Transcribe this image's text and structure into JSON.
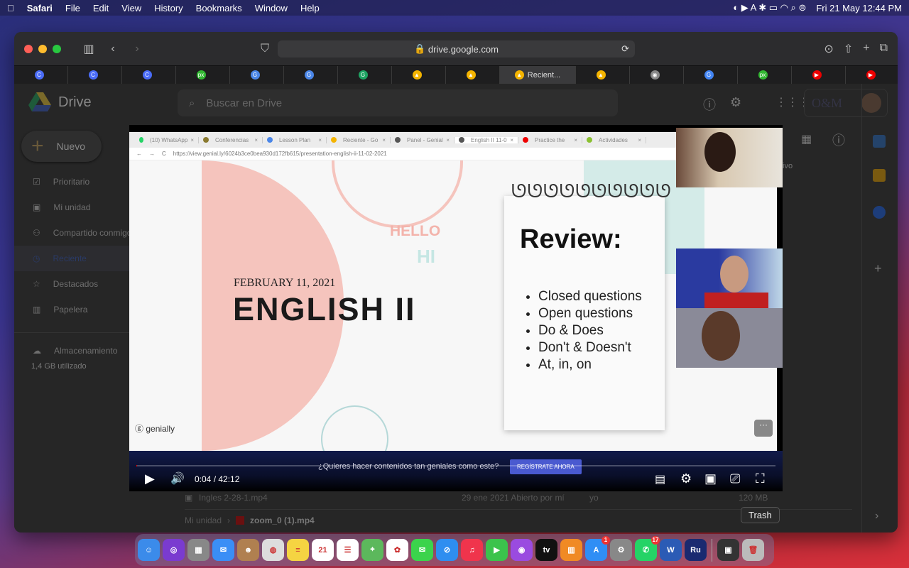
{
  "menubar": {
    "app": "Safari",
    "items": [
      "File",
      "Edit",
      "View",
      "History",
      "Bookmarks",
      "Window",
      "Help"
    ],
    "clock": "Fri 21 May  12:44 PM"
  },
  "safari": {
    "url": "drive.google.com",
    "active_tab": "Recient...",
    "tab_favicons": [
      {
        "c": "#4a6cf7",
        "t": "C"
      },
      {
        "c": "#4a6cf7",
        "t": "C"
      },
      {
        "c": "#4a6cf7",
        "t": "C"
      },
      {
        "c": "#33b833",
        "t": "px"
      },
      {
        "c": "#4a86e8",
        "t": "G"
      },
      {
        "c": "#4a86e8",
        "t": "G"
      },
      {
        "c": "#1ea362",
        "t": "G"
      },
      {
        "c": "#f4b400",
        "t": "▲"
      },
      {
        "c": "#f4b400",
        "t": "▲"
      },
      {
        "c": "#f4b400",
        "t": "▲"
      },
      {
        "c": "#888",
        "t": "◉"
      },
      {
        "c": "#4285f4",
        "t": "G"
      },
      {
        "c": "#33b833",
        "t": "px"
      },
      {
        "c": "#e00",
        "t": "▶"
      },
      {
        "c": "#e00",
        "t": "▶"
      },
      {
        "c": "#4a86e8",
        "t": "↓"
      }
    ]
  },
  "drive": {
    "logo": "Drive",
    "search_placeholder": "Buscar en Drive",
    "new_button": "Nuevo",
    "nav": [
      "Prioritario",
      "Mi unidad",
      "Compartido conmigo",
      "Reciente",
      "Destacados",
      "Papelera"
    ],
    "storage_label": "Almacenamiento",
    "storage_used": "1,4 GB utilizado",
    "header_partial": "ivo",
    "row": {
      "name": "Ingles 2-28-1.mp4",
      "date": "29 ene 2021  Abierto por mí",
      "owner": "yo",
      "size": "120 MB"
    },
    "breadcrumb": {
      "root": "Mi unidad",
      "file": "zoom_0 (1).mp4"
    },
    "org": "O&M"
  },
  "video": {
    "chrome_tabs": [
      "(10) WhatsApp",
      "Conferencias",
      "Lesson Plan",
      "Reciente - Go",
      "Panel - Genial",
      "English II 11-0",
      "Practice the",
      "Actividades"
    ],
    "chrome_url": "https://view.genial.ly/6024b3ce0bea930d172fb615/presentation-english-ii-11-02-2021",
    "slide": {
      "hello": "HELLO",
      "hi": "HI",
      "date": "FEBRUARY 11, 2021",
      "title": "ENGLISH II",
      "review": "Review:",
      "bullets": [
        "Closed questions",
        "Open questions",
        "Do & Does",
        "Don't & Doesn't",
        "At, in, on"
      ],
      "brand": "genially"
    },
    "banner_text": "¿Quieres hacer contenidos tan geniales como este?",
    "banner_button": "REGÍSTRATE AHORA",
    "time": "0:04 / 42:12",
    "progress": 0.0016
  },
  "dock": {
    "tooltip": "Trash",
    "apps": [
      {
        "n": "finder",
        "c": "#3b8bea",
        "t": "☺"
      },
      {
        "n": "siri",
        "c": "#7a3bd0",
        "t": "◎"
      },
      {
        "n": "launchpad",
        "c": "#888",
        "t": "▦"
      },
      {
        "n": "mail",
        "c": "#3a8ef6",
        "t": "✉"
      },
      {
        "n": "contacts",
        "c": "#b08050",
        "t": "☻"
      },
      {
        "n": "chrome",
        "c": "#ddd",
        "t": "◍"
      },
      {
        "n": "notes",
        "c": "#f5d442",
        "t": "≡"
      },
      {
        "n": "calendar",
        "c": "#fff",
        "t": "21"
      },
      {
        "n": "reminders",
        "c": "#fff",
        "t": "☰"
      },
      {
        "n": "maps",
        "c": "#5cb85c",
        "t": "⌖"
      },
      {
        "n": "photos",
        "c": "#fff",
        "t": "✿"
      },
      {
        "n": "messages",
        "c": "#3bd34c",
        "t": "✉"
      },
      {
        "n": "safari",
        "c": "#2e8ef0",
        "t": "⊘"
      },
      {
        "n": "music",
        "c": "#f0344c",
        "t": "♫"
      },
      {
        "n": "facetime",
        "c": "#3bc34c",
        "t": "▶"
      },
      {
        "n": "podcasts",
        "c": "#9a4be0",
        "t": "◉"
      },
      {
        "n": "tv",
        "c": "#111",
        "t": "tv"
      },
      {
        "n": "books",
        "c": "#f08a24",
        "t": "▥"
      },
      {
        "n": "app-store",
        "c": "#2f8ef5",
        "t": "A",
        "badge": "1"
      },
      {
        "n": "system-preferences",
        "c": "#888",
        "t": "⚙"
      },
      {
        "n": "whatsapp",
        "c": "#25d366",
        "t": "✆",
        "badge": "17"
      },
      {
        "n": "word",
        "c": "#2b5bb5",
        "t": "W"
      },
      {
        "n": "rush",
        "c": "#1a2a70",
        "t": "Ru"
      },
      {
        "n": "screenshot",
        "c": "#333",
        "t": "▣"
      },
      {
        "n": "trash",
        "c": "#bbb",
        "t": "🗑"
      }
    ]
  }
}
